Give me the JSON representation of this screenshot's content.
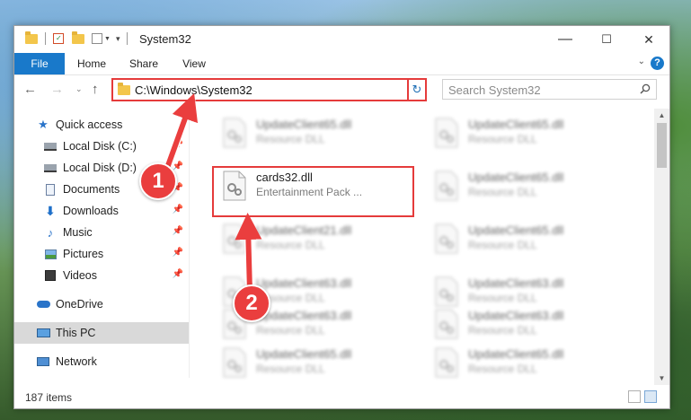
{
  "window": {
    "title": "System32",
    "controls": {
      "minimize": "—",
      "maximize": "☐",
      "close": "✕"
    }
  },
  "ribbon": {
    "tabs": [
      "File",
      "Home",
      "Share",
      "View"
    ],
    "help": "?"
  },
  "navigation": {
    "address": "C:\\Windows\\System32",
    "search_placeholder": "Search System32"
  },
  "sidebar": {
    "items": [
      {
        "label": "Quick access",
        "icon": "star-icon",
        "pinned": false
      },
      {
        "label": "Local Disk (C:)",
        "icon": "drive-icon",
        "pinned": true
      },
      {
        "label": "Local Disk (D:)",
        "icon": "drive-icon",
        "pinned": true
      },
      {
        "label": "Documents",
        "icon": "documents-icon",
        "pinned": true
      },
      {
        "label": "Downloads",
        "icon": "download-icon",
        "pinned": true
      },
      {
        "label": "Music",
        "icon": "music-icon",
        "pinned": true
      },
      {
        "label": "Pictures",
        "icon": "pictures-icon",
        "pinned": true
      },
      {
        "label": "Videos",
        "icon": "videos-icon",
        "pinned": true
      },
      {
        "label": "OneDrive",
        "icon": "cloud-icon",
        "pinned": false
      },
      {
        "label": "This PC",
        "icon": "computer-icon",
        "pinned": false,
        "selected": true
      },
      {
        "label": "Network",
        "icon": "network-icon",
        "pinned": false
      }
    ]
  },
  "files": {
    "left_column": [
      {
        "name": "UpdateClient65.dll",
        "desc": "Resource DLL",
        "blurred": true
      },
      {
        "name": "cards32.dll",
        "desc": "Entertainment Pack ...",
        "blurred": false,
        "highlighted": true
      },
      {
        "name": "UpdateClient21.dll",
        "desc": "Resource DLL",
        "blurred": true
      },
      {
        "name": "UpdateClient63.dll",
        "desc": "Resource DLL",
        "blurred": true
      },
      {
        "name": "UpdateClient63.dll",
        "desc": "Resource DLL",
        "blurred": true
      },
      {
        "name": "UpdateClient65.dll",
        "desc": "Resource DLL",
        "blurred": true
      }
    ],
    "right_column": [
      {
        "name": "UpdateClient65.dll",
        "desc": "Resource DLL",
        "blurred": true
      },
      {
        "name": "UpdateClient65.dll",
        "desc": "Resource DLL",
        "blurred": true
      },
      {
        "name": "UpdateClient65.dll",
        "desc": "Resource DLL",
        "blurred": true
      },
      {
        "name": "UpdateClient63.dll",
        "desc": "Resource DLL",
        "blurred": true
      },
      {
        "name": "UpdateClient63.dll",
        "desc": "Resource DLL",
        "blurred": true
      },
      {
        "name": "UpdateClient65.dll",
        "desc": "Resource DLL",
        "blurred": true
      }
    ]
  },
  "status": {
    "item_count": "187 items"
  },
  "annotations": {
    "marker_1": "1",
    "marker_2": "2"
  },
  "colors": {
    "accent": "#1979ca",
    "annotation_red": "#e53b3b"
  }
}
